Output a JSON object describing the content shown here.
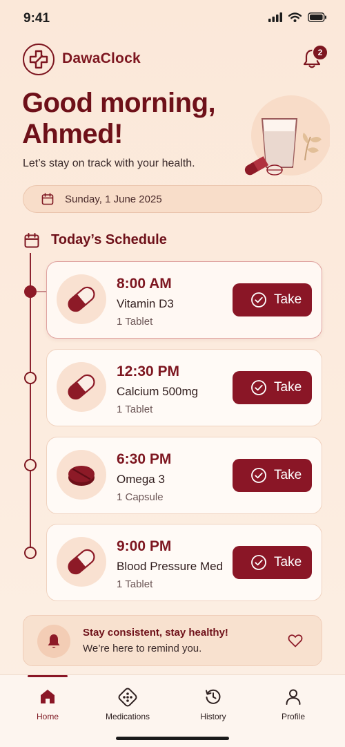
{
  "status_bar": {
    "time": "9:41"
  },
  "header": {
    "brand": "DawaClock",
    "notification_count": "2"
  },
  "greeting": {
    "title": "Good morning, Ahmed!",
    "subtitle": "Let’s stay on track with your health."
  },
  "date": {
    "label": "Sunday, 1 June 2025"
  },
  "schedule": {
    "title": "Today’s Schedule",
    "items": [
      {
        "time": "8:00 AM",
        "name": "Vitamin D3",
        "dose": "1 Tablet",
        "button": "Take",
        "icon": "capsule-icon",
        "active": true
      },
      {
        "time": "12:30 PM",
        "name": "Calcium 500mg",
        "dose": "1 Tablet",
        "button": "Take",
        "icon": "capsule-icon",
        "active": false
      },
      {
        "time": "6:30 PM",
        "name": "Omega 3",
        "dose": "1 Capsule",
        "button": "Take",
        "icon": "tablet-icon",
        "active": false
      },
      {
        "time": "9:00 PM",
        "name": "Blood Pressure Med",
        "dose": "1 Tablet",
        "button": "Take",
        "icon": "capsule-icon",
        "active": false
      }
    ]
  },
  "tip": {
    "title": "Stay consistent, stay healthy!",
    "text": "We’re here to remind you."
  },
  "nav": {
    "items": [
      {
        "label": "Home",
        "icon": "home-icon",
        "active": true
      },
      {
        "label": "Medications",
        "icon": "pills-icon",
        "active": false
      },
      {
        "label": "History",
        "icon": "history-icon",
        "active": false
      },
      {
        "label": "Profile",
        "icon": "profile-icon",
        "active": false
      }
    ]
  },
  "colors": {
    "accent": "#7d1620",
    "button": "#8a1626",
    "background": "#fbe8d9"
  }
}
